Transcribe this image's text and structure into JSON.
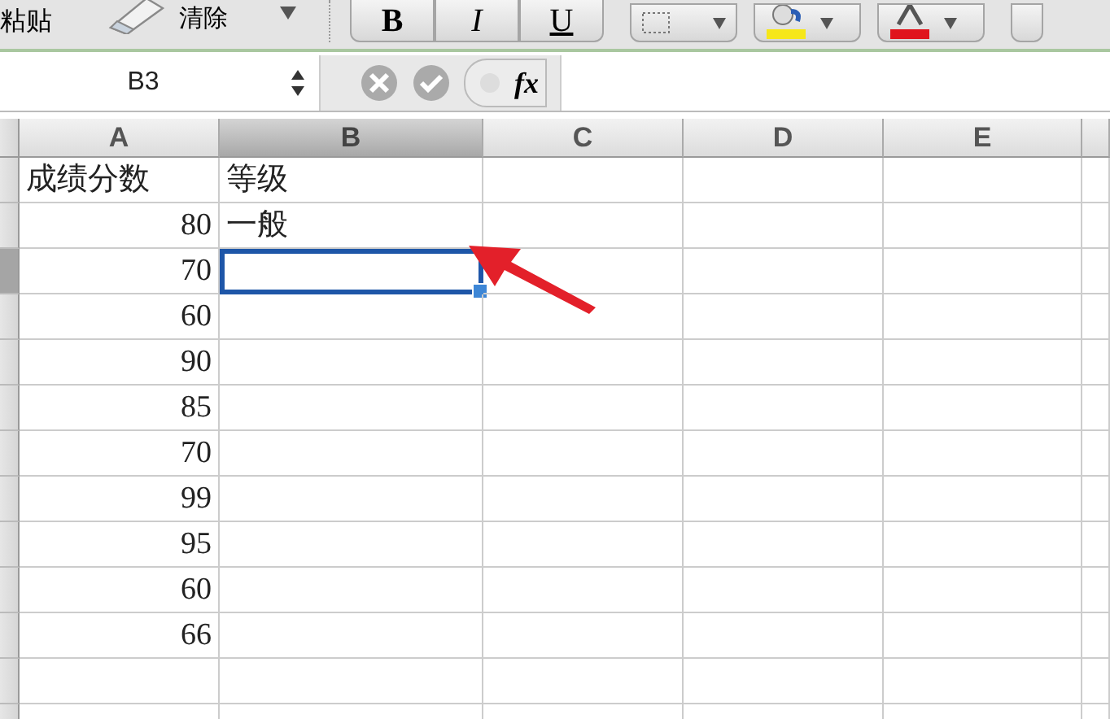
{
  "toolbar": {
    "paste_label": "粘贴",
    "clear_button": {
      "label": "清除"
    },
    "format_buttons": [
      {
        "label": "B",
        "kind": "bold"
      },
      {
        "label": "I",
        "kind": "italic"
      },
      {
        "label": "U",
        "kind": "underline"
      }
    ]
  },
  "formula_bar": {
    "name_box": "B3",
    "fx_label": "fx"
  },
  "columns": [
    {
      "label": "A",
      "selected": false
    },
    {
      "label": "B",
      "selected": true
    },
    {
      "label": "C",
      "selected": false
    },
    {
      "label": "D",
      "selected": false
    },
    {
      "label": "E",
      "selected": false
    }
  ],
  "rows": [
    {
      "selected": false,
      "cells": [
        {
          "text": "成绩分数",
          "kind": "text"
        },
        {
          "text": "等级",
          "kind": "text"
        }
      ]
    },
    {
      "selected": false,
      "cells": [
        {
          "text": "80",
          "kind": "number"
        },
        {
          "text": "一般",
          "kind": "text"
        }
      ]
    },
    {
      "selected": true,
      "cells": [
        {
          "text": "70",
          "kind": "number"
        }
      ]
    },
    {
      "selected": false,
      "cells": [
        {
          "text": "60",
          "kind": "number"
        }
      ]
    },
    {
      "selected": false,
      "cells": [
        {
          "text": "90",
          "kind": "number"
        }
      ]
    },
    {
      "selected": false,
      "cells": [
        {
          "text": "85",
          "kind": "number"
        }
      ]
    },
    {
      "selected": false,
      "cells": [
        {
          "text": "70",
          "kind": "number"
        }
      ]
    },
    {
      "selected": false,
      "cells": [
        {
          "text": "99",
          "kind": "number"
        }
      ]
    },
    {
      "selected": false,
      "cells": [
        {
          "text": "95",
          "kind": "number"
        }
      ]
    },
    {
      "selected": false,
      "cells": [
        {
          "text": "60",
          "kind": "number"
        }
      ]
    },
    {
      "selected": false,
      "cells": [
        {
          "text": "66",
          "kind": "number"
        }
      ]
    },
    {
      "selected": false
    },
    {
      "selected": false
    }
  ]
}
